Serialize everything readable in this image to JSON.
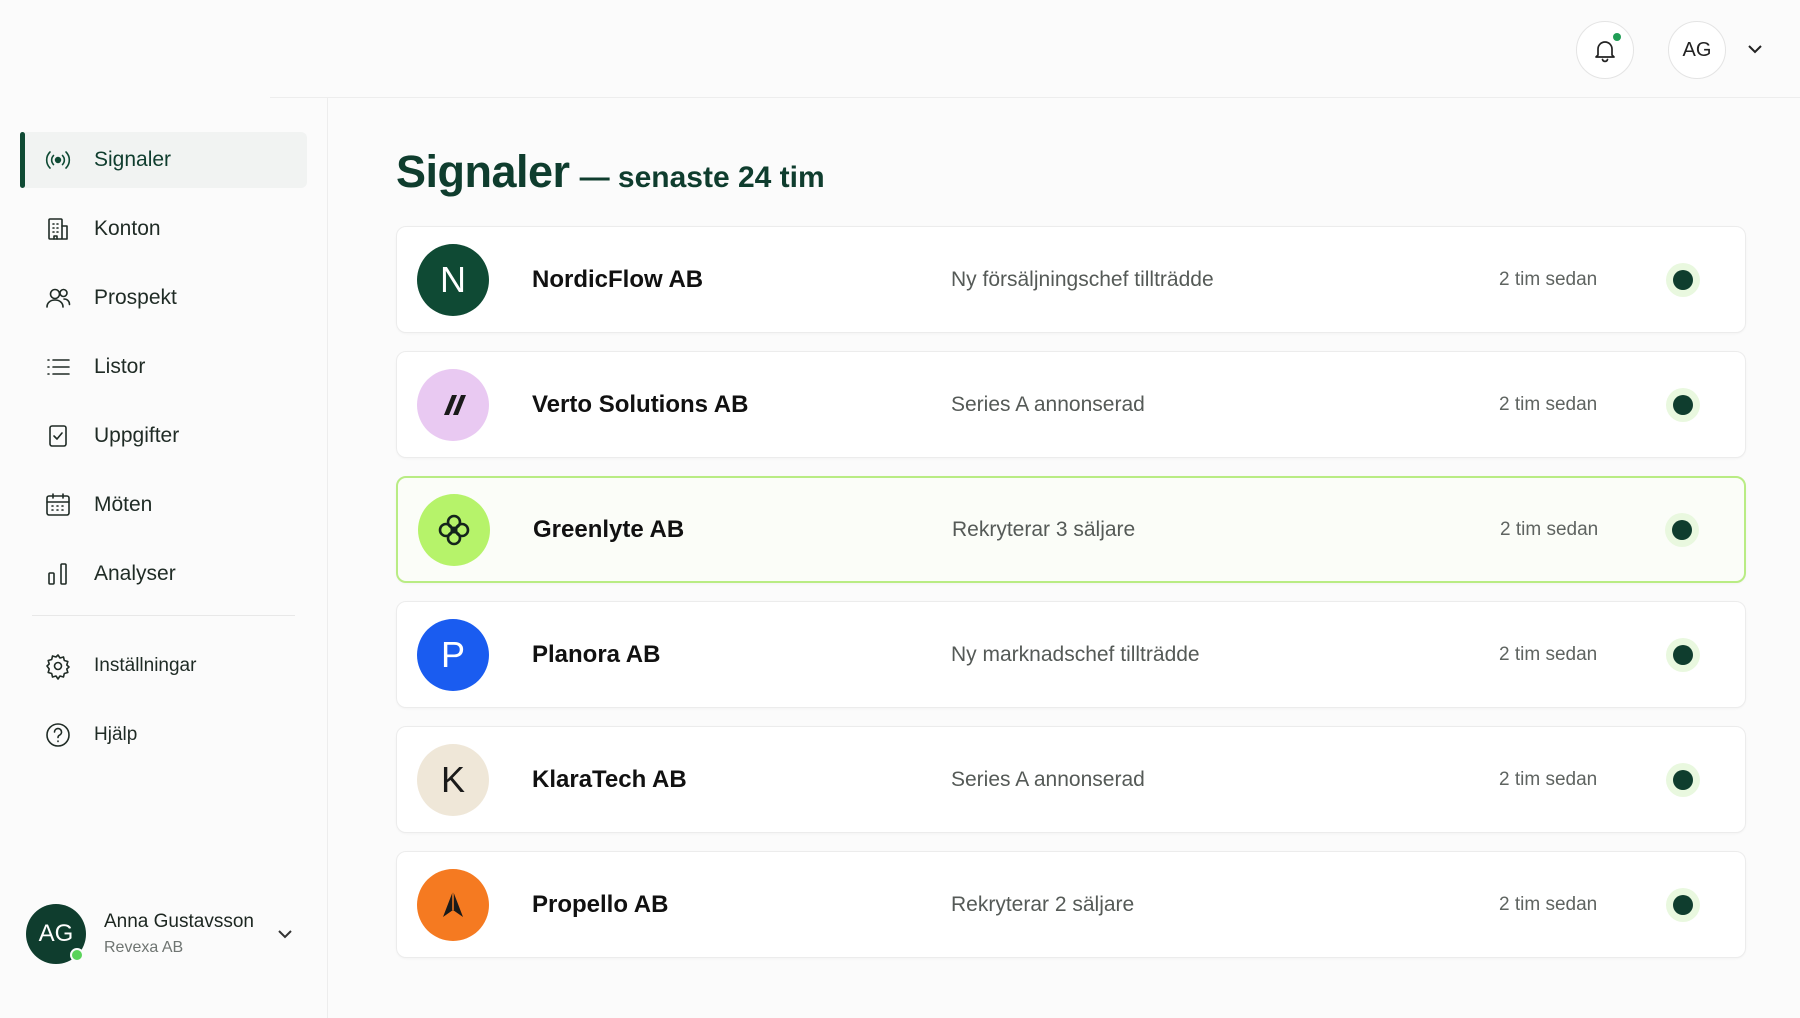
{
  "sidebar": {
    "nav": [
      {
        "label": "Signaler",
        "icon": "broadcast-icon",
        "active": true
      },
      {
        "label": "Konton",
        "icon": "building-icon"
      },
      {
        "label": "Prospekt",
        "icon": "users-icon"
      },
      {
        "label": "Listor",
        "icon": "list-icon"
      },
      {
        "label": "Uppgifter",
        "icon": "checkbox-icon"
      },
      {
        "label": "Möten",
        "icon": "calendar-icon"
      },
      {
        "label": "Analyser",
        "icon": "bar-chart-icon"
      }
    ],
    "secondary": [
      {
        "label": "Inställningar",
        "icon": "gear-icon"
      },
      {
        "label": "Hjälp",
        "icon": "help-circle-icon"
      }
    ],
    "user": {
      "initials": "AG",
      "name": "Anna Gustavsson",
      "org": "Revexa AB"
    }
  },
  "topbar": {
    "avatar_initials": "AG",
    "notification_icon": "bell-icon",
    "has_unread": true
  },
  "main": {
    "title": "Signaler",
    "subtitle": "— senaste 24 tim",
    "signals": [
      {
        "company": "NordicFlow AB",
        "event": "Ny försäljningschef tillträdde",
        "time": "2 tim sedan",
        "logo_text": "N",
        "logo_bg": "#0f4a34",
        "logo_fg": "#ffffff"
      },
      {
        "company": "Verto Solutions AB",
        "event": "Series A annonserad",
        "time": "2 tim sedan",
        "logo_text": "",
        "logo_icon": "slash-mark-icon",
        "logo_bg": "#e9c9f2",
        "logo_fg": "#1a1a1a"
      },
      {
        "company": "Greenlyte AB",
        "event": "Rekryterar 3 säljare",
        "time": "2 tim sedan",
        "logo_text": "",
        "logo_icon": "clover-icon",
        "logo_bg": "#b6f36a",
        "logo_fg": "#14241c",
        "highlight": true
      },
      {
        "company": "Planora AB",
        "event": "Ny marknadschef tillträdde",
        "time": "2 tim sedan",
        "logo_text": "P",
        "logo_bg": "#1a5cf0",
        "logo_fg": "#ffffff"
      },
      {
        "company": "KlaraTech AB",
        "event": "Series A annonserad",
        "time": "2 tim sedan",
        "logo_text": "K",
        "logo_bg": "#efe7d8",
        "logo_fg": "#1a1a1a"
      },
      {
        "company": "Propello AB",
        "event": "Rekryterar 2 säljare",
        "time": "2 tim sedan",
        "logo_text": "",
        "logo_icon": "arrow-mark-icon",
        "logo_bg": "#f57a21",
        "logo_fg": "#1a1a1a"
      }
    ]
  },
  "colors": {
    "brand_dark": "#0f3d2e",
    "highlight_border": "#b9ec84",
    "status_dot": "#0f3d2e",
    "status_glow": "#e9f8df"
  }
}
